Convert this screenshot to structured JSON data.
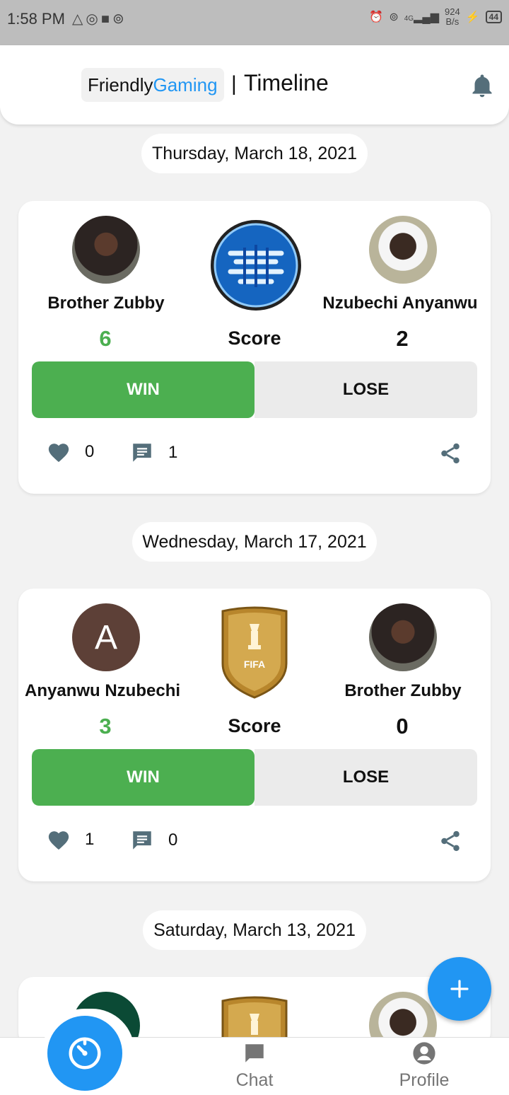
{
  "status_bar": {
    "time": "1:58 PM",
    "left_icons": [
      "warning-triangle-icon",
      "whatsapp-icon",
      "stop-square-icon",
      "hotspot-icon"
    ],
    "network_speed_value": "924",
    "network_speed_unit": "B/s",
    "signal": "4G",
    "battery": "44"
  },
  "header": {
    "brand_part1": "Friendly",
    "brand_part2": "Gaming",
    "separator": "|",
    "title": "Timeline",
    "brand_accent_color": "#2196f3"
  },
  "timeline": [
    {
      "date": "Thursday, March 18, 2021",
      "game_logo": "pes-logo",
      "player1": {
        "name": "Brother Zubby",
        "score": "6",
        "avatar": "photo"
      },
      "player2": {
        "name": "Nzubechi Anyanwu",
        "score": "2",
        "avatar": "photo"
      },
      "score_label": "Score",
      "win_label": "WIN",
      "lose_label": "LOSE",
      "likes": "0",
      "comments": "1"
    },
    {
      "date": "Wednesday, March 17, 2021",
      "game_logo": "fifa-world-champions-badge",
      "player1": {
        "name": "Anyanwu Nzubechi",
        "score": "3",
        "avatar_letter": "A"
      },
      "player2": {
        "name": "Brother Zubby",
        "score": "0",
        "avatar": "photo"
      },
      "score_label": "Score",
      "win_label": "WIN",
      "lose_label": "LOSE",
      "likes": "1",
      "comments": "0"
    },
    {
      "date": "Saturday, March 13, 2021",
      "game_logo": "fifa-world-champions-badge"
    }
  ],
  "fab": {
    "icon": "plus-icon"
  },
  "bottom_nav": {
    "timer_icon": "timer-icon",
    "chat_label": "Chat",
    "profile_label": "Profile"
  },
  "colors": {
    "win_green": "#4caf50",
    "primary_blue": "#2196f3",
    "icon_grey": "#546e7a"
  }
}
